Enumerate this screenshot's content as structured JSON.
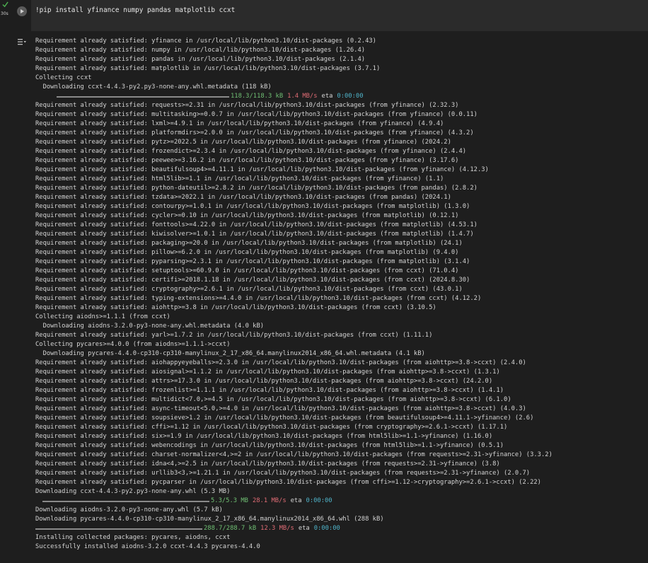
{
  "cell": {
    "exec_time": "30s",
    "code": "!pip install yfinance numpy pandas matplotlib ccxt"
  },
  "output": {
    "lines": [
      {
        "t": "text",
        "text": "Requirement already satisfied: yfinance in /usr/local/lib/python3.10/dist-packages (0.2.43)"
      },
      {
        "t": "text",
        "text": "Requirement already satisfied: numpy in /usr/local/lib/python3.10/dist-packages (1.26.4)"
      },
      {
        "t": "text",
        "text": "Requirement already satisfied: pandas in /usr/local/lib/python3.10/dist-packages (2.1.4)"
      },
      {
        "t": "text",
        "text": "Requirement already satisfied: matplotlib in /usr/local/lib/python3.10/dist-packages (3.7.1)"
      },
      {
        "t": "text",
        "text": "Collecting ccxt"
      },
      {
        "t": "text",
        "text": "  Downloading ccxt-4.4.3-py2.py3-none-any.whl.metadata (118 kB)"
      },
      {
        "t": "progress",
        "size": "118.3/118.3 kB",
        "speed": "1.4 MB/s",
        "eta_label": "eta",
        "eta": "0:00:00"
      },
      {
        "t": "text",
        "text": "Requirement already satisfied: requests>=2.31 in /usr/local/lib/python3.10/dist-packages (from yfinance) (2.32.3)"
      },
      {
        "t": "text",
        "text": "Requirement already satisfied: multitasking>=0.0.7 in /usr/local/lib/python3.10/dist-packages (from yfinance) (0.0.11)"
      },
      {
        "t": "text",
        "text": "Requirement already satisfied: lxml>=4.9.1 in /usr/local/lib/python3.10/dist-packages (from yfinance) (4.9.4)"
      },
      {
        "t": "text",
        "text": "Requirement already satisfied: platformdirs>=2.0.0 in /usr/local/lib/python3.10/dist-packages (from yfinance) (4.3.2)"
      },
      {
        "t": "text",
        "text": "Requirement already satisfied: pytz>=2022.5 in /usr/local/lib/python3.10/dist-packages (from yfinance) (2024.2)"
      },
      {
        "t": "text",
        "text": "Requirement already satisfied: frozendict>=2.3.4 in /usr/local/lib/python3.10/dist-packages (from yfinance) (2.4.4)"
      },
      {
        "t": "text",
        "text": "Requirement already satisfied: peewee>=3.16.2 in /usr/local/lib/python3.10/dist-packages (from yfinance) (3.17.6)"
      },
      {
        "t": "text",
        "text": "Requirement already satisfied: beautifulsoup4>=4.11.1 in /usr/local/lib/python3.10/dist-packages (from yfinance) (4.12.3)"
      },
      {
        "t": "text",
        "text": "Requirement already satisfied: html5lib>=1.1 in /usr/local/lib/python3.10/dist-packages (from yfinance) (1.1)"
      },
      {
        "t": "text",
        "text": "Requirement already satisfied: python-dateutil>=2.8.2 in /usr/local/lib/python3.10/dist-packages (from pandas) (2.8.2)"
      },
      {
        "t": "text",
        "text": "Requirement already satisfied: tzdata>=2022.1 in /usr/local/lib/python3.10/dist-packages (from pandas) (2024.1)"
      },
      {
        "t": "text",
        "text": "Requirement already satisfied: contourpy>=1.0.1 in /usr/local/lib/python3.10/dist-packages (from matplotlib) (1.3.0)"
      },
      {
        "t": "text",
        "text": "Requirement already satisfied: cycler>=0.10 in /usr/local/lib/python3.10/dist-packages (from matplotlib) (0.12.1)"
      },
      {
        "t": "text",
        "text": "Requirement already satisfied: fonttools>=4.22.0 in /usr/local/lib/python3.10/dist-packages (from matplotlib) (4.53.1)"
      },
      {
        "t": "text",
        "text": "Requirement already satisfied: kiwisolver>=1.0.1 in /usr/local/lib/python3.10/dist-packages (from matplotlib) (1.4.7)"
      },
      {
        "t": "text",
        "text": "Requirement already satisfied: packaging>=20.0 in /usr/local/lib/python3.10/dist-packages (from matplotlib) (24.1)"
      },
      {
        "t": "text",
        "text": "Requirement already satisfied: pillow>=6.2.0 in /usr/local/lib/python3.10/dist-packages (from matplotlib) (9.4.0)"
      },
      {
        "t": "text",
        "text": "Requirement already satisfied: pyparsing>=2.3.1 in /usr/local/lib/python3.10/dist-packages (from matplotlib) (3.1.4)"
      },
      {
        "t": "text",
        "text": "Requirement already satisfied: setuptools>=60.9.0 in /usr/local/lib/python3.10/dist-packages (from ccxt) (71.0.4)"
      },
      {
        "t": "text",
        "text": "Requirement already satisfied: certifi>=2018.1.18 in /usr/local/lib/python3.10/dist-packages (from ccxt) (2024.8.30)"
      },
      {
        "t": "text",
        "text": "Requirement already satisfied: cryptography>=2.6.1 in /usr/local/lib/python3.10/dist-packages (from ccxt) (43.0.1)"
      },
      {
        "t": "text",
        "text": "Requirement already satisfied: typing-extensions>=4.4.0 in /usr/local/lib/python3.10/dist-packages (from ccxt) (4.12.2)"
      },
      {
        "t": "text",
        "text": "Requirement already satisfied: aiohttp>=3.8 in /usr/local/lib/python3.10/dist-packages (from ccxt) (3.10.5)"
      },
      {
        "t": "text",
        "text": "Collecting aiodns>=1.1.1 (from ccxt)"
      },
      {
        "t": "text",
        "text": "  Downloading aiodns-3.2.0-py3-none-any.whl.metadata (4.0 kB)"
      },
      {
        "t": "text",
        "text": "Requirement already satisfied: yarl>=1.7.2 in /usr/local/lib/python3.10/dist-packages (from ccxt) (1.11.1)"
      },
      {
        "t": "text",
        "text": "Collecting pycares>=4.0.0 (from aiodns>=1.1.1->ccxt)"
      },
      {
        "t": "text",
        "text": "  Downloading pycares-4.4.0-cp310-cp310-manylinux_2_17_x86_64.manylinux2014_x86_64.whl.metadata (4.1 kB)"
      },
      {
        "t": "text",
        "text": "Requirement already satisfied: aiohappyeyeballs>=2.3.0 in /usr/local/lib/python3.10/dist-packages (from aiohttp>=3.8->ccxt) (2.4.0)"
      },
      {
        "t": "text",
        "text": "Requirement already satisfied: aiosignal>=1.1.2 in /usr/local/lib/python3.10/dist-packages (from aiohttp>=3.8->ccxt) (1.3.1)"
      },
      {
        "t": "text",
        "text": "Requirement already satisfied: attrs>=17.3.0 in /usr/local/lib/python3.10/dist-packages (from aiohttp>=3.8->ccxt) (24.2.0)"
      },
      {
        "t": "text",
        "text": "Requirement already satisfied: frozenlist>=1.1.1 in /usr/local/lib/python3.10/dist-packages (from aiohttp>=3.8->ccxt) (1.4.1)"
      },
      {
        "t": "text",
        "text": "Requirement already satisfied: multidict<7.0,>=4.5 in /usr/local/lib/python3.10/dist-packages (from aiohttp>=3.8->ccxt) (6.1.0)"
      },
      {
        "t": "text",
        "text": "Requirement already satisfied: async-timeout<5.0,>=4.0 in /usr/local/lib/python3.10/dist-packages (from aiohttp>=3.8->ccxt) (4.0.3)"
      },
      {
        "t": "text",
        "text": "Requirement already satisfied: soupsieve>1.2 in /usr/local/lib/python3.10/dist-packages (from beautifulsoup4>=4.11.1->yfinance) (2.6)"
      },
      {
        "t": "text",
        "text": "Requirement already satisfied: cffi>=1.12 in /usr/local/lib/python3.10/dist-packages (from cryptography>=2.6.1->ccxt) (1.17.1)"
      },
      {
        "t": "text",
        "text": "Requirement already satisfied: six>=1.9 in /usr/local/lib/python3.10/dist-packages (from html5lib>=1.1->yfinance) (1.16.0)"
      },
      {
        "t": "text",
        "text": "Requirement already satisfied: webencodings in /usr/local/lib/python3.10/dist-packages (from html5lib>=1.1->yfinance) (0.5.1)"
      },
      {
        "t": "text",
        "text": "Requirement already satisfied: charset-normalizer<4,>=2 in /usr/local/lib/python3.10/dist-packages (from requests>=2.31->yfinance) (3.3.2)"
      },
      {
        "t": "text",
        "text": "Requirement already satisfied: idna<4,>=2.5 in /usr/local/lib/python3.10/dist-packages (from requests>=2.31->yfinance) (3.8)"
      },
      {
        "t": "text",
        "text": "Requirement already satisfied: urllib3<3,>=1.21.1 in /usr/local/lib/python3.10/dist-packages (from requests>=2.31->yfinance) (2.0.7)"
      },
      {
        "t": "text",
        "text": "Requirement already satisfied: pycparser in /usr/local/lib/python3.10/dist-packages (from cffi>=1.12->cryptography>=2.6.1->ccxt) (2.22)"
      },
      {
        "t": "text",
        "text": "Downloading ccxt-4.4.3-py2.py3-none-any.whl (5.3 MB)"
      },
      {
        "t": "progress",
        "size": "5.3/5.3 MB",
        "speed": "28.1 MB/s",
        "eta_label": "eta",
        "eta": "0:00:00"
      },
      {
        "t": "text",
        "text": "Downloading aiodns-3.2.0-py3-none-any.whl (5.7 kB)"
      },
      {
        "t": "text",
        "text": "Downloading pycares-4.4.0-cp310-cp310-manylinux_2_17_x86_64.manylinux2014_x86_64.whl (288 kB)"
      },
      {
        "t": "progress",
        "size": "288.7/288.7 kB",
        "speed": "12.3 MB/s",
        "eta_label": "eta",
        "eta": "0:00:00"
      },
      {
        "t": "text",
        "text": "Installing collected packages: pycares, aiodns, ccxt"
      },
      {
        "t": "text",
        "text": "Successfully installed aiodns-3.2.0 ccxt-4.4.3 pycares-4.4.0"
      }
    ]
  },
  "colors": {
    "size": "#6fbf73",
    "speed": "#e06c75",
    "eta": "#4fb3c9"
  },
  "icons": {
    "status": "check-icon",
    "run": "play-icon",
    "output_menu": "output-menu-icon"
  }
}
